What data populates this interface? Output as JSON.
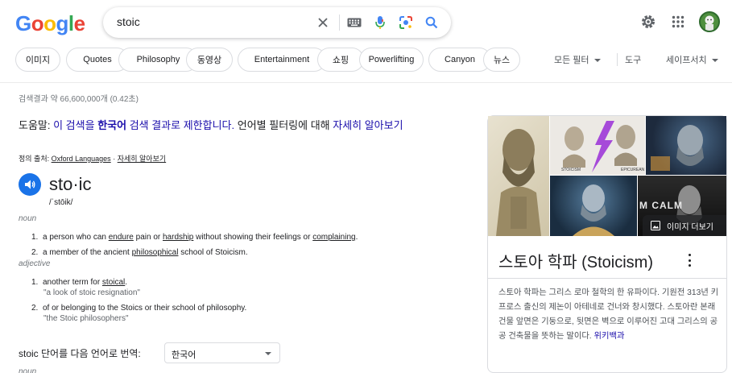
{
  "logo": {
    "letters": [
      "G",
      "o",
      "o",
      "g",
      "l",
      "e"
    ],
    "colors": [
      "#4285F4",
      "#EA4335",
      "#FBBC05",
      "#4285F4",
      "#34A853",
      "#EA4335"
    ]
  },
  "search": {
    "query": "stoic"
  },
  "header_icons": {
    "clear": "close-icon",
    "keyboard": "keyboard-icon",
    "voice": "microphone-icon",
    "lens": "google-lens-icon",
    "search": "search-icon",
    "settings": "gear-icon",
    "apps": "apps-grid-icon",
    "account": "avatar"
  },
  "chips": [
    "이미지",
    "Quotes",
    "Philosophy",
    "동영상",
    "Entertainment",
    "쇼핑",
    "Powerlifting",
    "Canyon",
    "뉴스"
  ],
  "tools": {
    "all_filters": "모든 필터",
    "tools": "도구",
    "safesearch": "세이프서치"
  },
  "results": {
    "stats": "검색결과 약 66,600,000개 (0.42초)",
    "tip": {
      "prefix": "도움말: ",
      "link1": "이 검색을 ",
      "bold": "한국어",
      "link2": " 검색 결과로 제한합니다.",
      "middle": " 언어별 필터링에 대해 ",
      "link3": "자세히 알아보기"
    }
  },
  "dictionary": {
    "source_prefix": "정의 출처: ",
    "source": "Oxford Languages",
    "source_sep": " · ",
    "learn_more": "자세히 알아보기",
    "word": "sto·ic",
    "pronunciation": "/ˈstōik/",
    "noun": {
      "label": "noun",
      "defs": [
        {
          "num": "1.",
          "parts": [
            "a person who can ",
            "endure",
            " pain or ",
            "hardship",
            " without showing their feelings or ",
            "complaining",
            "."
          ]
        },
        {
          "num": "2.",
          "parts": [
            "a member of the ancient ",
            "philosophical",
            " school of Stoicism."
          ]
        }
      ]
    },
    "adjective": {
      "label": "adjective",
      "defs": [
        {
          "num": "1.",
          "parts": [
            "another term for ",
            "stoical",
            "."
          ],
          "example": "\"a look of stoic resignation\""
        },
        {
          "num": "2.",
          "parts": [
            "of or belonging to the Stoics or their school of philosophy."
          ],
          "example": "\"the Stoic philosophers\""
        }
      ]
    },
    "translate_label": "stoic 단어를 다음 언어로 번역:",
    "translate_language": "한국어",
    "noun_again": "noun"
  },
  "knowledge_panel": {
    "image_labels": [
      "STOICISM",
      "EPICUREAN",
      "M CALM"
    ],
    "more_images": "이미지 더보기",
    "title": "스토아 학파 (Stoicism)",
    "description": "스토아 학파는 그리스 로마 철학의 한 유파이다. 기원전 313년 키프로스 출신의 제논이 아테네로 건너와 창시했다. 스토아란 본래 건물 앞면은 기둥으로, 뒷면은 벽으로 이루어진 고대 그리스의 공공 건축물을 뜻하는 말이다.",
    "source": "위키백과"
  }
}
